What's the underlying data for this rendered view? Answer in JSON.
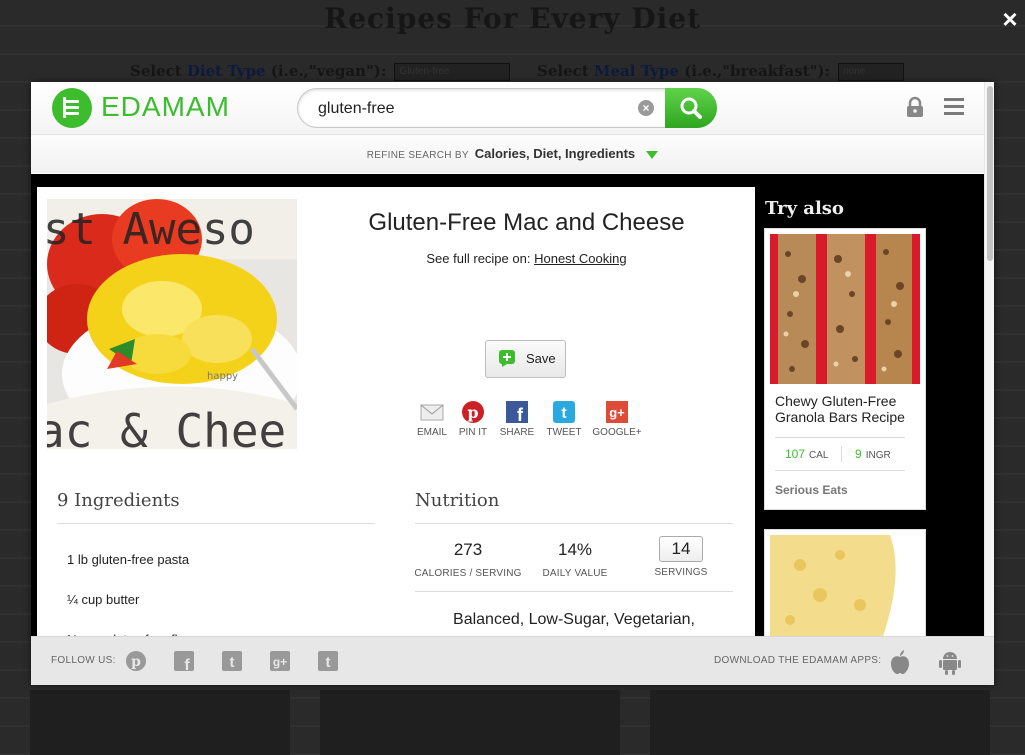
{
  "background_page": {
    "title": "Recipes For Every Diet",
    "diet_label_pre": "Select ",
    "diet_label_hl": "Diet Type",
    "diet_label_post": " (i.e.,\"vegan\"):",
    "diet_value": "Gluten-free",
    "meal_label_pre": "Select ",
    "meal_label_hl": "Meal Type",
    "meal_label_post": " (i.e.,\"breakfast\"):",
    "meal_value": "none"
  },
  "modal": {
    "close_icon": "×",
    "brand": "EDAMAM",
    "search": {
      "value": "gluten-free",
      "clear": "×"
    },
    "refine": {
      "prefix": "REFINE SEARCH BY",
      "options": "Calories, Diet, Ingredients"
    },
    "recipe": {
      "title": "Gluten-Free Mac and Cheese",
      "full_recipe_prefix": "See full recipe on:",
      "source": "Honest Cooking",
      "save_label": "Save",
      "image_text_top": "st Aweso",
      "image_text_bottom": "ac & Chee",
      "image_text_cup": "happy",
      "share": [
        {
          "label": "EMAIL",
          "icon": "email-icon"
        },
        {
          "label": "PIN IT",
          "icon": "pinterest-icon"
        },
        {
          "label": "SHARE",
          "icon": "facebook-icon"
        },
        {
          "label": "TWEET",
          "icon": "twitter-icon"
        },
        {
          "label": "GOOGLE+",
          "icon": "google-plus-icon"
        }
      ]
    },
    "ingredients": {
      "title": "9 Ingredients",
      "items": [
        "1 lb gluten-free pasta",
        "¼ cup butter",
        "⅓ cup gluten free flour"
      ]
    },
    "nutrition": {
      "title": "Nutrition",
      "calories": "273",
      "calories_label": "CALORIES / SERVING",
      "daily_value": "14%",
      "daily_value_label": "DAILY VALUE",
      "servings": "14",
      "servings_label": "SERVINGS",
      "labels": "Balanced, Low-Sugar, Vegetarian,"
    },
    "try_also": {
      "title": "Try also",
      "cards": [
        {
          "name": "Chewy Gluten-Free Granola Bars Recipe",
          "cal": "107",
          "cal_unit": "CAL",
          "ingr": "9",
          "ingr_unit": "INGR",
          "source": "Serious Eats"
        }
      ]
    },
    "footer": {
      "follow_label": "FOLLOW US:",
      "download_label": "DOWNLOAD THE EDAMAM APPS:"
    },
    "colors": {
      "brand_green": "#3dbd2e",
      "pinterest": "#cb2027",
      "facebook": "#3b5998",
      "twitter": "#2aa9e0",
      "google": "#dd4b39"
    }
  }
}
